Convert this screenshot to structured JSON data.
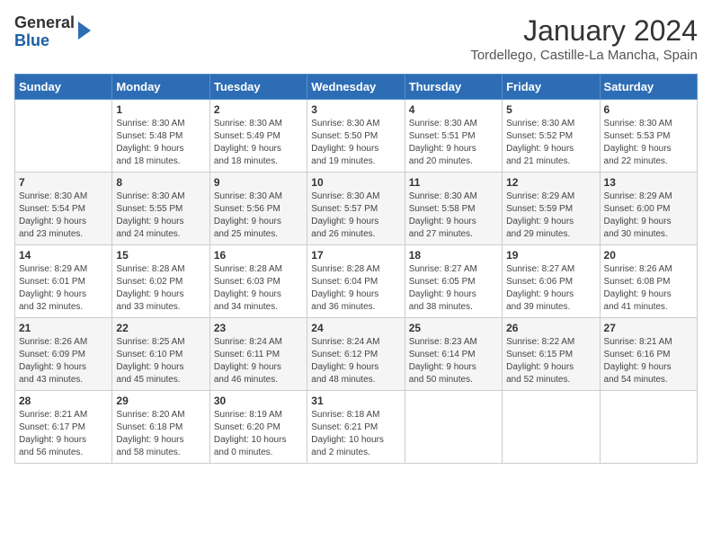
{
  "logo": {
    "general": "General",
    "blue": "Blue"
  },
  "title": "January 2024",
  "location": "Tordellego, Castille-La Mancha, Spain",
  "days_of_week": [
    "Sunday",
    "Monday",
    "Tuesday",
    "Wednesday",
    "Thursday",
    "Friday",
    "Saturday"
  ],
  "weeks": [
    [
      {
        "day": "",
        "info": ""
      },
      {
        "day": "1",
        "info": "Sunrise: 8:30 AM\nSunset: 5:48 PM\nDaylight: 9 hours\nand 18 minutes."
      },
      {
        "day": "2",
        "info": "Sunrise: 8:30 AM\nSunset: 5:49 PM\nDaylight: 9 hours\nand 18 minutes."
      },
      {
        "day": "3",
        "info": "Sunrise: 8:30 AM\nSunset: 5:50 PM\nDaylight: 9 hours\nand 19 minutes."
      },
      {
        "day": "4",
        "info": "Sunrise: 8:30 AM\nSunset: 5:51 PM\nDaylight: 9 hours\nand 20 minutes."
      },
      {
        "day": "5",
        "info": "Sunrise: 8:30 AM\nSunset: 5:52 PM\nDaylight: 9 hours\nand 21 minutes."
      },
      {
        "day": "6",
        "info": "Sunrise: 8:30 AM\nSunset: 5:53 PM\nDaylight: 9 hours\nand 22 minutes."
      }
    ],
    [
      {
        "day": "7",
        "info": "Sunrise: 8:30 AM\nSunset: 5:54 PM\nDaylight: 9 hours\nand 23 minutes."
      },
      {
        "day": "8",
        "info": "Sunrise: 8:30 AM\nSunset: 5:55 PM\nDaylight: 9 hours\nand 24 minutes."
      },
      {
        "day": "9",
        "info": "Sunrise: 8:30 AM\nSunset: 5:56 PM\nDaylight: 9 hours\nand 25 minutes."
      },
      {
        "day": "10",
        "info": "Sunrise: 8:30 AM\nSunset: 5:57 PM\nDaylight: 9 hours\nand 26 minutes."
      },
      {
        "day": "11",
        "info": "Sunrise: 8:30 AM\nSunset: 5:58 PM\nDaylight: 9 hours\nand 27 minutes."
      },
      {
        "day": "12",
        "info": "Sunrise: 8:29 AM\nSunset: 5:59 PM\nDaylight: 9 hours\nand 29 minutes."
      },
      {
        "day": "13",
        "info": "Sunrise: 8:29 AM\nSunset: 6:00 PM\nDaylight: 9 hours\nand 30 minutes."
      }
    ],
    [
      {
        "day": "14",
        "info": "Sunrise: 8:29 AM\nSunset: 6:01 PM\nDaylight: 9 hours\nand 32 minutes."
      },
      {
        "day": "15",
        "info": "Sunrise: 8:28 AM\nSunset: 6:02 PM\nDaylight: 9 hours\nand 33 minutes."
      },
      {
        "day": "16",
        "info": "Sunrise: 8:28 AM\nSunset: 6:03 PM\nDaylight: 9 hours\nand 34 minutes."
      },
      {
        "day": "17",
        "info": "Sunrise: 8:28 AM\nSunset: 6:04 PM\nDaylight: 9 hours\nand 36 minutes."
      },
      {
        "day": "18",
        "info": "Sunrise: 8:27 AM\nSunset: 6:05 PM\nDaylight: 9 hours\nand 38 minutes."
      },
      {
        "day": "19",
        "info": "Sunrise: 8:27 AM\nSunset: 6:06 PM\nDaylight: 9 hours\nand 39 minutes."
      },
      {
        "day": "20",
        "info": "Sunrise: 8:26 AM\nSunset: 6:08 PM\nDaylight: 9 hours\nand 41 minutes."
      }
    ],
    [
      {
        "day": "21",
        "info": "Sunrise: 8:26 AM\nSunset: 6:09 PM\nDaylight: 9 hours\nand 43 minutes."
      },
      {
        "day": "22",
        "info": "Sunrise: 8:25 AM\nSunset: 6:10 PM\nDaylight: 9 hours\nand 45 minutes."
      },
      {
        "day": "23",
        "info": "Sunrise: 8:24 AM\nSunset: 6:11 PM\nDaylight: 9 hours\nand 46 minutes."
      },
      {
        "day": "24",
        "info": "Sunrise: 8:24 AM\nSunset: 6:12 PM\nDaylight: 9 hours\nand 48 minutes."
      },
      {
        "day": "25",
        "info": "Sunrise: 8:23 AM\nSunset: 6:14 PM\nDaylight: 9 hours\nand 50 minutes."
      },
      {
        "day": "26",
        "info": "Sunrise: 8:22 AM\nSunset: 6:15 PM\nDaylight: 9 hours\nand 52 minutes."
      },
      {
        "day": "27",
        "info": "Sunrise: 8:21 AM\nSunset: 6:16 PM\nDaylight: 9 hours\nand 54 minutes."
      }
    ],
    [
      {
        "day": "28",
        "info": "Sunrise: 8:21 AM\nSunset: 6:17 PM\nDaylight: 9 hours\nand 56 minutes."
      },
      {
        "day": "29",
        "info": "Sunrise: 8:20 AM\nSunset: 6:18 PM\nDaylight: 9 hours\nand 58 minutes."
      },
      {
        "day": "30",
        "info": "Sunrise: 8:19 AM\nSunset: 6:20 PM\nDaylight: 10 hours\nand 0 minutes."
      },
      {
        "day": "31",
        "info": "Sunrise: 8:18 AM\nSunset: 6:21 PM\nDaylight: 10 hours\nand 2 minutes."
      },
      {
        "day": "",
        "info": ""
      },
      {
        "day": "",
        "info": ""
      },
      {
        "day": "",
        "info": ""
      }
    ]
  ]
}
